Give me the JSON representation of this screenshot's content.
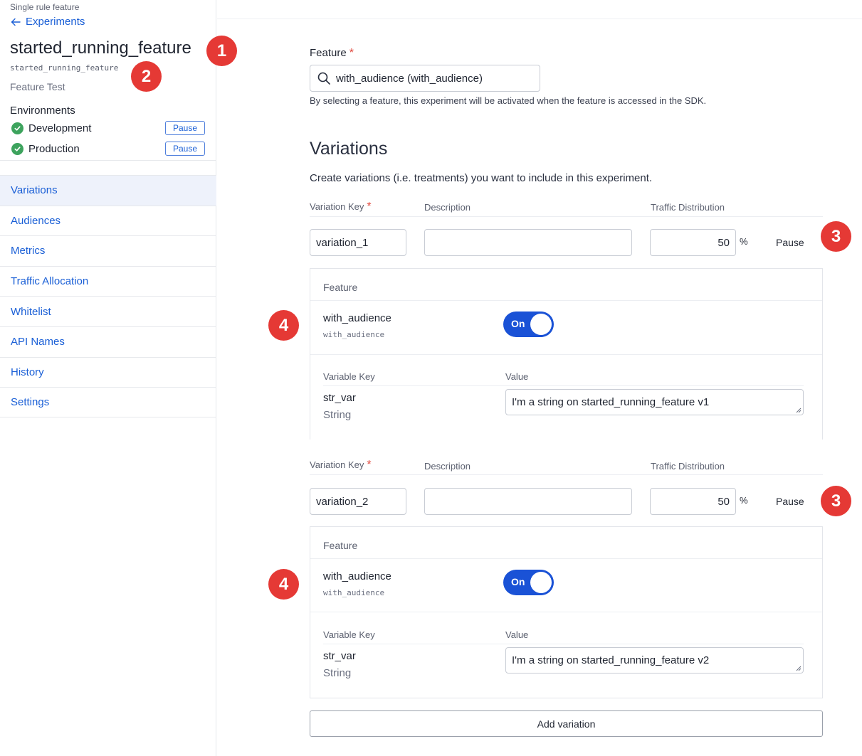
{
  "sidebar": {
    "feature_type_label": "Single rule feature",
    "back_link": "Experiments",
    "title": "started_running_feature",
    "key": "started_running_feature",
    "subtitle": "Feature Test",
    "environments_title": "Environments",
    "environments": [
      {
        "name": "Development",
        "action": "Pause",
        "status": "running"
      },
      {
        "name": "Production",
        "action": "Pause",
        "status": "running"
      }
    ],
    "nav": [
      {
        "label": "Variations",
        "active": true
      },
      {
        "label": "Audiences"
      },
      {
        "label": "Metrics"
      },
      {
        "label": "Traffic Allocation"
      },
      {
        "label": "Whitelist"
      },
      {
        "label": "API Names"
      },
      {
        "label": "History"
      },
      {
        "label": "Settings"
      }
    ]
  },
  "main": {
    "feature_label": "Feature",
    "feature_value": "with_audience (with_audience)",
    "feature_help": "By selecting a feature, this experiment will be activated when the feature is accessed in the SDK.",
    "variations_title": "Variations",
    "variations_desc": "Create variations (i.e. treatments) you want to include in this experiment.",
    "col_key": "Variation Key",
    "col_desc": "Description",
    "col_traffic": "Traffic Distribution",
    "variations": [
      {
        "key": "variation_1",
        "description": "",
        "traffic": "50",
        "pct": "%",
        "pause": "Pause",
        "feature_label": "Feature",
        "feature_name": "with_audience",
        "feature_key": "with_audience",
        "toggle": "On",
        "var_key_label": "Variable Key",
        "value_label": "Value",
        "var_name": "str_var",
        "var_type": "String",
        "var_value": "I'm a string on started_running_feature v1"
      },
      {
        "key": "variation_2",
        "description": "",
        "traffic": "50",
        "pct": "%",
        "pause": "Pause",
        "feature_label": "Feature",
        "feature_name": "with_audience",
        "feature_key": "with_audience",
        "toggle": "On",
        "var_key_label": "Variable Key",
        "value_label": "Value",
        "var_name": "str_var",
        "var_type": "String",
        "var_value": "I'm a string on started_running_feature v2"
      }
    ],
    "add_variation": "Add variation"
  },
  "annotations": {
    "b1": "1",
    "b2": "2",
    "b3": "3",
    "b4": "4"
  },
  "colors": {
    "link": "#1a5fd6",
    "toggle_on": "#1a52d6",
    "required": "#e0463b",
    "badge": "#e53935",
    "status_ok": "#3da35d"
  }
}
